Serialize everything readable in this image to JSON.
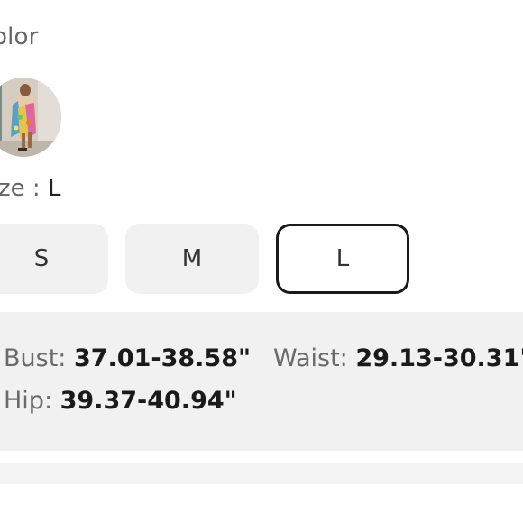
{
  "color_section": {
    "label": "olor",
    "swatch_name": "floral-dress-thumbnail"
  },
  "size_section": {
    "label": "ze : ",
    "selected_value": "L",
    "options": [
      "S",
      "M",
      "L"
    ],
    "selected_index": 2
  },
  "measurements": {
    "bust_label": "Bust: ",
    "bust_value": "37.01-38.58\"",
    "waist_label": "Waist: ",
    "waist_value": "29.13-30.31\"",
    "hip_label": "Hip: ",
    "hip_value": "39.37-40.94\""
  },
  "colors": {
    "selected_border": "#1a1a1a",
    "button_bg": "#f1f1f1",
    "panel_bg": "#f1f1f1"
  }
}
